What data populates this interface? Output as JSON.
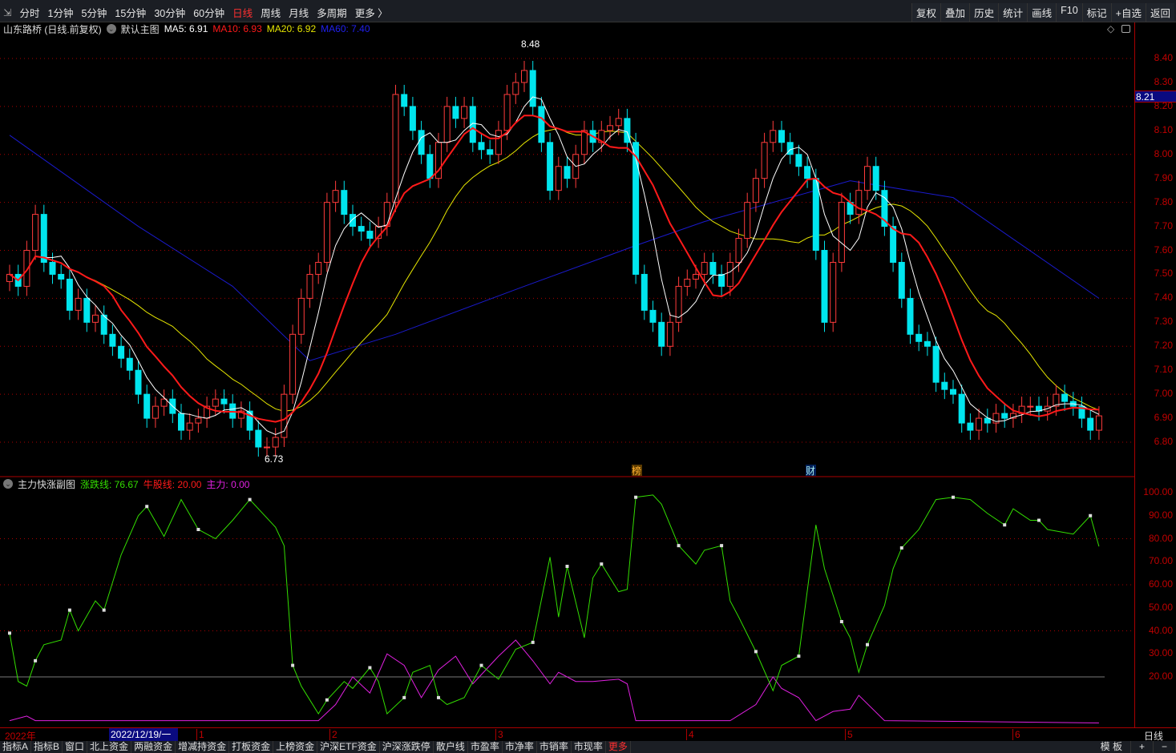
{
  "toolbar": {
    "periods": [
      "分时",
      "1分钟",
      "5分钟",
      "15分钟",
      "30分钟",
      "60分钟",
      "日线",
      "周线",
      "月线",
      "多周期",
      "更多 〉"
    ],
    "active": "日线",
    "actions": [
      "复权",
      "叠加",
      "历史",
      "统计",
      "画线",
      "F10",
      "标记",
      "+自选",
      "返回"
    ]
  },
  "info": {
    "title": "山东路桥 (日线.前复权)",
    "template": "默认主图",
    "ma5": "MA5: 6.91",
    "ma10": "MA10: 6.93",
    "ma20": "MA20: 6.92",
    "ma60": "MA60: 7.40"
  },
  "indicator": {
    "title": "主力快涨副图",
    "line1": "涨跌线: 76.67",
    "line2": "牛股线: 20.00",
    "line3": "主力: 0.00"
  },
  "colors": {
    "up": "#ff3b3b",
    "down": "#00e5ee",
    "ma5": "#ffffff",
    "ma10": "#ff1a1a",
    "ma20": "#e6e600",
    "ma60": "#1a1acc",
    "green": "#33dd00",
    "magenta": "#e020e0"
  },
  "price_axis": {
    "labels": [
      "8.40",
      "8.30",
      "8.20",
      "8.10",
      "8.00",
      "7.90",
      "7.80",
      "7.70",
      "7.60",
      "7.50",
      "7.40",
      "7.30",
      "7.20",
      "7.10",
      "7.00",
      "6.90",
      "6.80"
    ],
    "current": "8.21"
  },
  "ind_axis": {
    "labels": [
      "100.00",
      "90.00",
      "80.00",
      "70.00",
      "60.00",
      "50.00",
      "40.00",
      "30.00",
      "20.00"
    ]
  },
  "annotations": {
    "high": "8.48",
    "low": "6.73",
    "bang": "榜",
    "cai": "财"
  },
  "xaxis": {
    "year": "2022年",
    "cursor": "2022/12/19/一",
    "months": [
      "1",
      "2",
      "3",
      "4",
      "5",
      "6"
    ],
    "period": "日线"
  },
  "tabs": [
    "指标A",
    "指标B",
    "窗口",
    "北上资金",
    "两融资金",
    "增减持资金",
    "打板资金",
    "上榜资金",
    "沪深ETF资金",
    "沪深涨跌停",
    "散户线",
    "市盈率",
    "市净率",
    "市销率",
    "市现率"
  ],
  "tabs_more": "更多",
  "tabs_right": [
    "模 板",
    "+",
    "−"
  ],
  "chart_data": {
    "type": "candlestick",
    "close": [
      7.5,
      7.45,
      7.6,
      7.75,
      7.55,
      7.5,
      7.48,
      7.35,
      7.4,
      7.3,
      7.33,
      7.25,
      7.2,
      7.15,
      7.1,
      7.0,
      6.9,
      6.95,
      6.98,
      6.92,
      6.85,
      6.88,
      6.9,
      6.95,
      6.98,
      6.96,
      6.9,
      6.93,
      6.85,
      6.78,
      6.78,
      6.82,
      7.0,
      7.25,
      7.4,
      7.5,
      7.55,
      7.8,
      7.85,
      7.75,
      7.7,
      7.68,
      7.65,
      7.7,
      7.8,
      8.25,
      8.2,
      8.1,
      8.0,
      7.9,
      8.05,
      8.2,
      8.15,
      8.2,
      8.05,
      8.02,
      8.0,
      8.1,
      8.25,
      8.3,
      8.35,
      8.2,
      8.05,
      7.85,
      7.95,
      7.9,
      8.0,
      8.1,
      8.05,
      8.1,
      8.12,
      8.15,
      8.05,
      7.5,
      7.35,
      7.3,
      7.2,
      7.3,
      7.45,
      7.48,
      7.5,
      7.55,
      7.5,
      7.45,
      7.55,
      7.65,
      7.8,
      7.9,
      8.05,
      8.1,
      8.05,
      8.0,
      7.95,
      7.9,
      7.6,
      7.3,
      7.55,
      7.8,
      7.75,
      7.85,
      7.95,
      7.85,
      7.7,
      7.55,
      7.4,
      7.25,
      7.22,
      7.2,
      7.05,
      7.02,
      7.0,
      6.88,
      6.85,
      6.9,
      6.88,
      6.92,
      6.9,
      6.92,
      6.95,
      6.95,
      6.93,
      6.95,
      7.0,
      6.97,
      6.95,
      6.9,
      6.85,
      6.91
    ],
    "ma60": [
      [
        0,
        8.08
      ],
      [
        15,
        7.7
      ],
      [
        26,
        7.45
      ],
      [
        35,
        7.14
      ],
      [
        45,
        7.25
      ],
      [
        60,
        7.45
      ],
      [
        73,
        7.62
      ],
      [
        81,
        7.72
      ],
      [
        98,
        7.89
      ],
      [
        110,
        7.82
      ],
      [
        127,
        7.4
      ]
    ],
    "zhangdie": [
      [
        0,
        39
      ],
      [
        1,
        18
      ],
      [
        2,
        16
      ],
      [
        3,
        27
      ],
      [
        4,
        34
      ],
      [
        6,
        36
      ],
      [
        7,
        49
      ],
      [
        8,
        40
      ],
      [
        10,
        53
      ],
      [
        11,
        49
      ],
      [
        13,
        73
      ],
      [
        15,
        90
      ],
      [
        16,
        94
      ],
      [
        18,
        81
      ],
      [
        20,
        97
      ],
      [
        22,
        84
      ],
      [
        24,
        80
      ],
      [
        26,
        88
      ],
      [
        28,
        97
      ],
      [
        31,
        85
      ],
      [
        32,
        77
      ],
      [
        33,
        25
      ],
      [
        34,
        16
      ],
      [
        36,
        4
      ],
      [
        37,
        10
      ],
      [
        39,
        18
      ],
      [
        40,
        15
      ],
      [
        42,
        24
      ],
      [
        43,
        18
      ],
      [
        44,
        4
      ],
      [
        46,
        11
      ],
      [
        47,
        22
      ],
      [
        49,
        25
      ],
      [
        50,
        11
      ],
      [
        51,
        8
      ],
      [
        53,
        11
      ],
      [
        55,
        25
      ],
      [
        57,
        19
      ],
      [
        59,
        32
      ],
      [
        61,
        35
      ],
      [
        63,
        72
      ],
      [
        64,
        46
      ],
      [
        65,
        68
      ],
      [
        67,
        37
      ],
      [
        68,
        63
      ],
      [
        69,
        69
      ],
      [
        71,
        57
      ],
      [
        72,
        58
      ],
      [
        73,
        98
      ],
      [
        75,
        99
      ],
      [
        76,
        95
      ],
      [
        78,
        77
      ],
      [
        80,
        69
      ],
      [
        81,
        75
      ],
      [
        83,
        77
      ],
      [
        84,
        53
      ],
      [
        85,
        46
      ],
      [
        87,
        31
      ],
      [
        89,
        14
      ],
      [
        90,
        25
      ],
      [
        92,
        29
      ],
      [
        94,
        86
      ],
      [
        95,
        67
      ],
      [
        97,
        44
      ],
      [
        98,
        37
      ],
      [
        99,
        22
      ],
      [
        100,
        34
      ],
      [
        102,
        51
      ],
      [
        103,
        67
      ],
      [
        104,
        76
      ],
      [
        106,
        84
      ],
      [
        108,
        97
      ],
      [
        110,
        98
      ],
      [
        112,
        97
      ],
      [
        114,
        91
      ],
      [
        116,
        86
      ],
      [
        117,
        93
      ],
      [
        119,
        88
      ],
      [
        120,
        88
      ],
      [
        121,
        84
      ],
      [
        124,
        82
      ],
      [
        126,
        90
      ],
      [
        127,
        76.67
      ]
    ],
    "niugu": 20,
    "zhuli": [
      [
        0,
        1
      ],
      [
        2,
        3
      ],
      [
        3,
        1
      ],
      [
        36,
        1
      ],
      [
        38,
        8
      ],
      [
        40,
        20
      ],
      [
        42,
        13
      ],
      [
        44,
        30
      ],
      [
        46,
        25
      ],
      [
        48,
        11
      ],
      [
        50,
        23
      ],
      [
        52,
        29
      ],
      [
        54,
        17
      ],
      [
        57,
        29
      ],
      [
        59,
        36
      ],
      [
        61,
        27
      ],
      [
        63,
        17
      ],
      [
        64,
        22
      ],
      [
        66,
        18
      ],
      [
        68,
        18
      ],
      [
        71,
        19
      ],
      [
        72,
        17
      ],
      [
        73,
        1
      ],
      [
        84,
        1
      ],
      [
        87,
        8
      ],
      [
        89,
        20
      ],
      [
        90,
        15
      ],
      [
        92,
        11
      ],
      [
        94,
        1
      ],
      [
        96,
        5
      ],
      [
        98,
        6
      ],
      [
        99,
        12
      ],
      [
        102,
        1
      ],
      [
        127,
        0
      ]
    ],
    "price_range": [
      6.7,
      8.55
    ],
    "ind_range": [
      0,
      105
    ]
  }
}
